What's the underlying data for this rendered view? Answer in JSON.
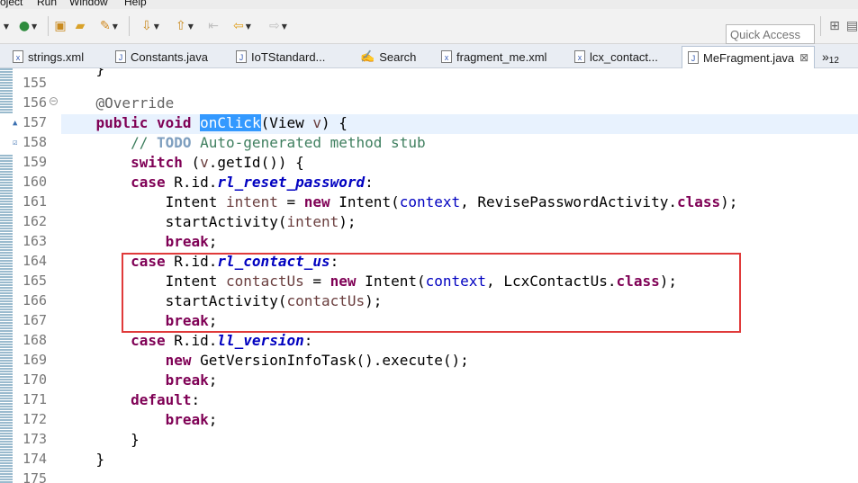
{
  "menu": [
    "oject",
    "Run",
    "Window",
    "Help"
  ],
  "toolbar": {
    "quick_access_placeholder": "Quick Access"
  },
  "tabs": [
    {
      "label": "strings.xml",
      "icon": "xml-file-icon"
    },
    {
      "label": "Constants.java",
      "icon": "java-file-icon"
    },
    {
      "label": "IoTStandard...",
      "icon": "java-file-icon"
    },
    {
      "label": "Search",
      "icon": "search-icon"
    },
    {
      "label": "fragment_me.xml",
      "icon": "xml-file-icon"
    },
    {
      "label": "lcx_contact...",
      "icon": "xml-file-icon"
    },
    {
      "label": "MeFragment.java",
      "icon": "java-file-icon",
      "active": true,
      "close": "⊠"
    }
  ],
  "overflow": {
    "chevron": "»",
    "count": "12"
  },
  "editor": {
    "line_numbers": [
      "155",
      "156",
      "157",
      "158",
      "159",
      "160",
      "161",
      "162",
      "163",
      "164",
      "165",
      "166",
      "167",
      "168",
      "169",
      "170",
      "171",
      "172",
      "173",
      "174",
      "175"
    ],
    "current_line": "157",
    "selected_word": "onClick"
  },
  "colors": {
    "keyword": "#7f0055",
    "comment": "#3f7f5f",
    "field": "#0000c0",
    "selection": "#3399ff",
    "annotation_box": "#e03a3a"
  }
}
